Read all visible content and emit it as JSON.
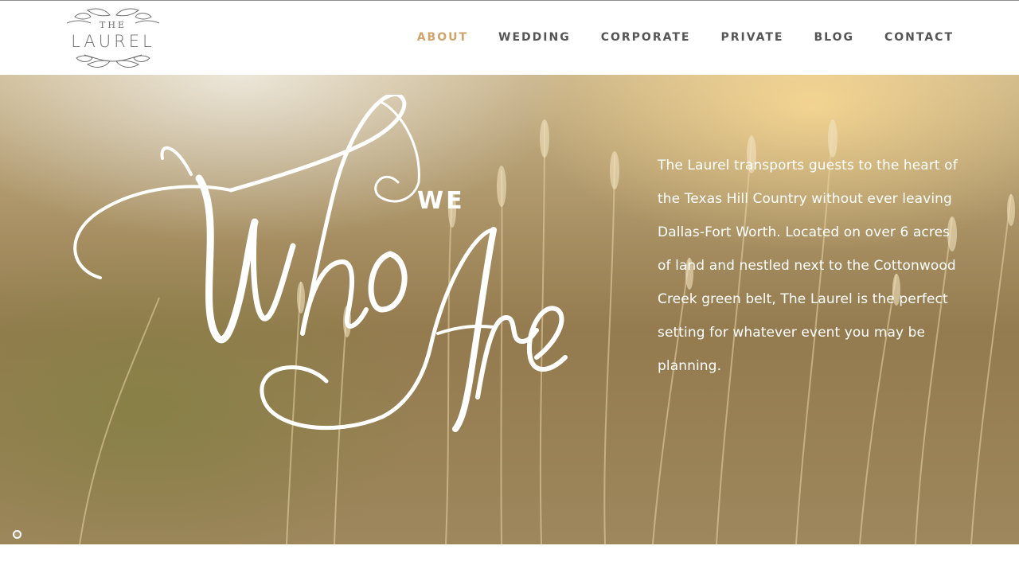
{
  "logo": {
    "line1": "THE",
    "line2": "LAUREL"
  },
  "nav": {
    "items": [
      {
        "label": "ABOUT",
        "active": true
      },
      {
        "label": "WEDDING",
        "active": false
      },
      {
        "label": "CORPORATE",
        "active": false
      },
      {
        "label": "PRIVATE",
        "active": false
      },
      {
        "label": "BLOG",
        "active": false
      },
      {
        "label": "CONTACT",
        "active": false
      }
    ]
  },
  "hero": {
    "heading_small": "WE",
    "heading_script_1": "Who",
    "heading_script_2": "Are",
    "description": "The Laurel transports guests to the heart of the Texas Hill Country without ever leaving Dallas-Fort Worth. Located on over 6 acres of land and nestled next to the Cottonwood Creek green belt, The Laurel is the perfect setting for whatever event you may be planning."
  },
  "colors": {
    "accent": "#d1a46c",
    "nav_text": "#555555",
    "logo_text": "#6f6f6f"
  },
  "icons": {
    "logo": "laurel-leaves-icon",
    "slider": "slider-dot-icon"
  }
}
